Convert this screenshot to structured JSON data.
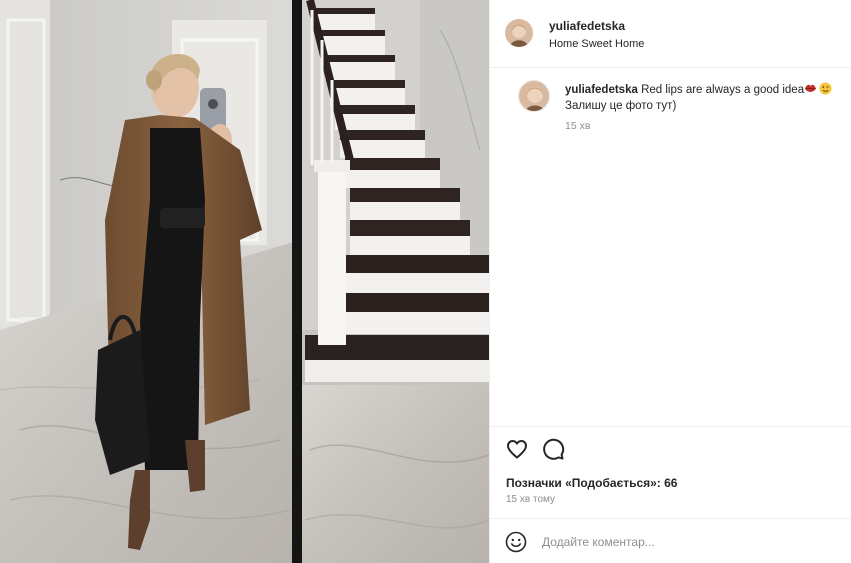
{
  "post": {
    "photo_alt_icon": "mirror-selfie-photo",
    "author": {
      "username": "yuliafedetska",
      "location": "Home Sweet Home"
    },
    "caption": {
      "username": "yuliafedetska",
      "text": "Red lips are always a good idea",
      "emoji_icons": [
        "lips-emoji-icon",
        "wink-emoji-icon"
      ],
      "line2": "Залишу це фото тут)",
      "time": "15 хв"
    },
    "actions": {
      "icons": [
        "heart-icon",
        "comment-icon"
      ],
      "likes_label": "Позначки «Подобається»: 66",
      "posted_time": "15 хв тому"
    },
    "composer": {
      "emoji_icon": "smiley-icon",
      "placeholder": "Додайте коментар..."
    }
  }
}
